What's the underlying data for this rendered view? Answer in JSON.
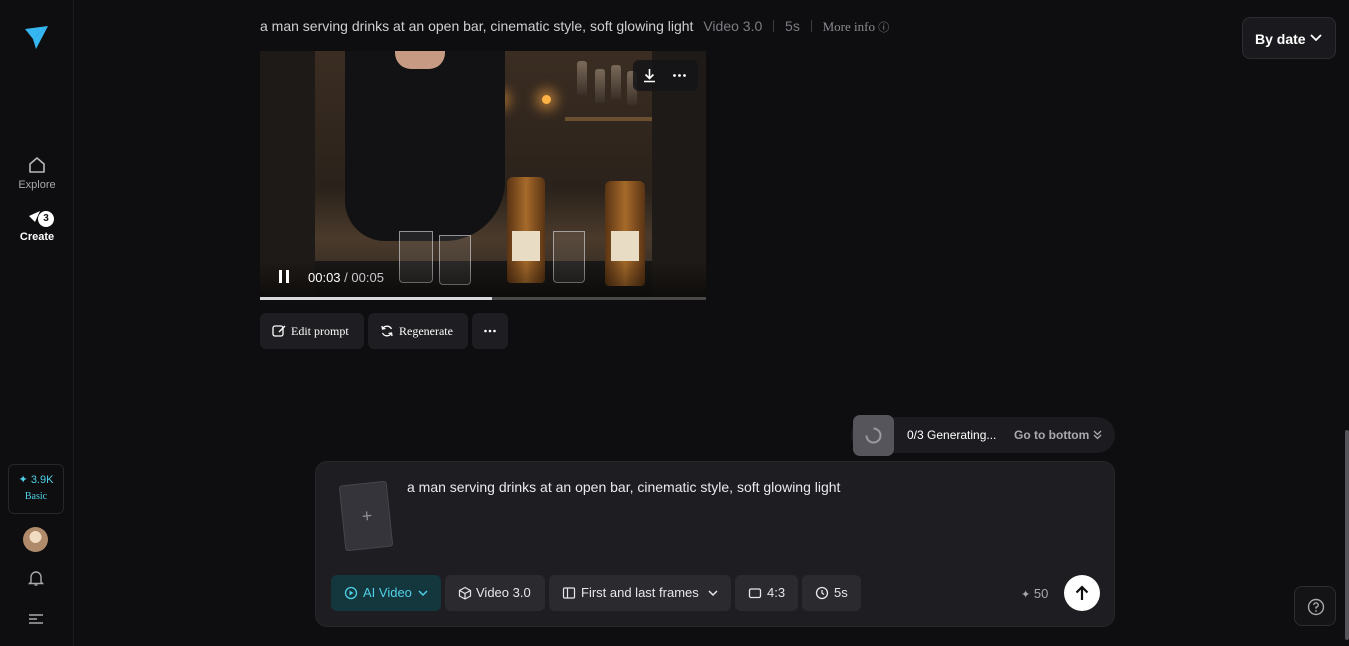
{
  "sidebar": {
    "nav": [
      {
        "label": "Explore",
        "icon": "home-icon"
      },
      {
        "label": "Create",
        "icon": "create-icon",
        "badge": "3"
      }
    ],
    "credits": {
      "amount": "3.9K",
      "plan": "Basic"
    }
  },
  "header": {
    "prompt": "a man serving drinks at an open bar, cinematic style, soft glowing light",
    "model": "Video 3.0",
    "duration": "5s",
    "more_info": "More info",
    "sort_label": "By date"
  },
  "player": {
    "current_time": "00:03",
    "total_time": "/ 00:05",
    "progress_fraction": 0.52
  },
  "actions": {
    "edit_prompt": "Edit prompt",
    "regenerate": "Regenerate"
  },
  "generating": {
    "status": "0/3 Generating...",
    "go_to_bottom": "Go to bottom"
  },
  "composer": {
    "upload_plus": "+",
    "prompt": "a man serving drinks at an open bar, cinematic style, soft glowing light",
    "chips": {
      "mode": "AI Video",
      "model": "Video 3.0",
      "frames": "First and last frames",
      "ratio": "4:3",
      "duration": "5s"
    },
    "cost": "50"
  },
  "colors": {
    "accent": "#4fd1e8",
    "background": "#0e0e10",
    "panel": "#1e1e22"
  }
}
